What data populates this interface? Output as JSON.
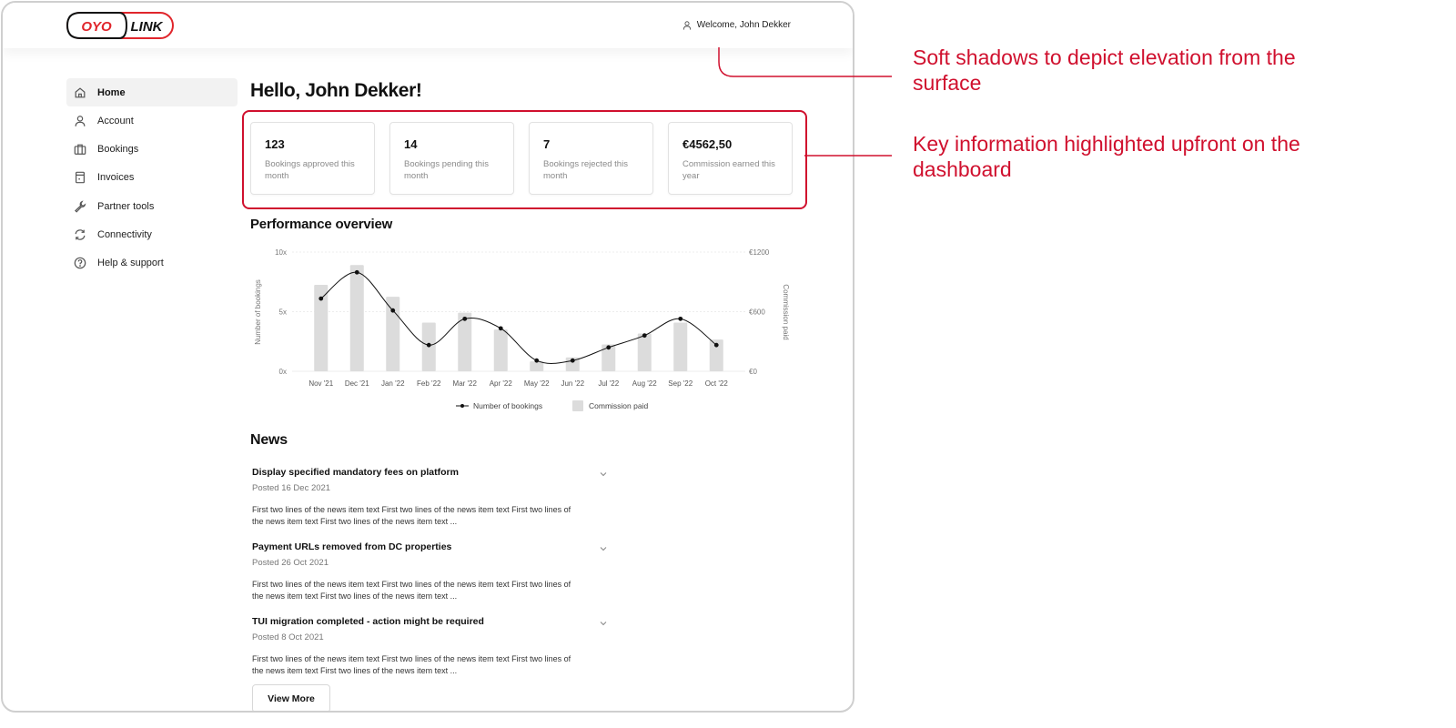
{
  "brand": {
    "logo_left": "OYO",
    "logo_right": "LINK",
    "accent": "#e0252b"
  },
  "header": {
    "welcome": "Welcome, John Dekker"
  },
  "sidebar": {
    "items": [
      {
        "label": "Home",
        "icon": "home-icon"
      },
      {
        "label": "Account",
        "icon": "user-icon"
      },
      {
        "label": "Bookings",
        "icon": "briefcase-icon"
      },
      {
        "label": "Invoices",
        "icon": "invoice-icon"
      },
      {
        "label": "Partner tools",
        "icon": "wrench-icon"
      },
      {
        "label": "Connectivity",
        "icon": "sync-icon"
      },
      {
        "label": "Help & support",
        "icon": "help-icon"
      }
    ]
  },
  "main": {
    "greeting": "Hello, John Dekker!",
    "cards": [
      {
        "value": "123",
        "label": "Bookings approved this month"
      },
      {
        "value": "14",
        "label": "Bookings pending this month"
      },
      {
        "value": "7",
        "label": "Bookings rejected this month"
      },
      {
        "value": "€4562,50",
        "label": "Commission earned this year"
      }
    ],
    "performance_title": "Performance overview",
    "news_title": "News",
    "news": [
      {
        "title": "Display specified mandatory fees on platform",
        "date": "Posted 16 Dec 2021",
        "text": "First two lines of the news item text First two lines of the news item text First two lines of the news item text First two lines of the news item text ..."
      },
      {
        "title": "Payment URLs removed from DC properties",
        "date": "Posted 26 Oct 2021",
        "text": "First two lines of the news item text First two lines of the news item text First two lines of the news item text First two lines of the news item text ..."
      },
      {
        "title": "TUI migration completed - action might be required",
        "date": "Posted 8 Oct 2021",
        "text": "First two lines of the news item text First two lines of the news item text First two lines of the news item text First two lines of the news item text ..."
      }
    ],
    "view_more": "View More"
  },
  "chart_data": {
    "type": "bar",
    "categories": [
      "Nov '21",
      "Dec '21",
      "Jan '22",
      "Feb '22",
      "Mar '22",
      "Apr '22",
      "May '22",
      "Jun '22",
      "Jul '22",
      "Aug '22",
      "Sep '22",
      "Oct '22"
    ],
    "series": [
      {
        "name": "Number of bookings",
        "type": "line",
        "axis": "left",
        "values": [
          6.1,
          8.3,
          5.1,
          2.2,
          4.4,
          3.6,
          0.9,
          0.9,
          2.0,
          3.0,
          4.4,
          2.2
        ],
        "color": "#111111"
      },
      {
        "name": "Commission paid",
        "type": "bar",
        "axis": "right",
        "values": [
          870,
          1070,
          750,
          490,
          590,
          420,
          100,
          140,
          270,
          380,
          490,
          320
        ],
        "color": "#dcdcdc"
      }
    ],
    "ylabel": "Number of bookings",
    "y2label": "Commission paid",
    "yticks": [
      "0x",
      "5x",
      "10x"
    ],
    "y2ticks": [
      "€0",
      "€600",
      "€1200"
    ],
    "ylim": [
      0,
      10
    ],
    "y2lim": [
      0,
      1200
    ],
    "grid": true,
    "legend": "bottom"
  },
  "annotations": [
    {
      "text": "Soft shadows to depict elevation from the surface"
    },
    {
      "text": "Key information highlighted upfront on the dashboard"
    }
  ]
}
